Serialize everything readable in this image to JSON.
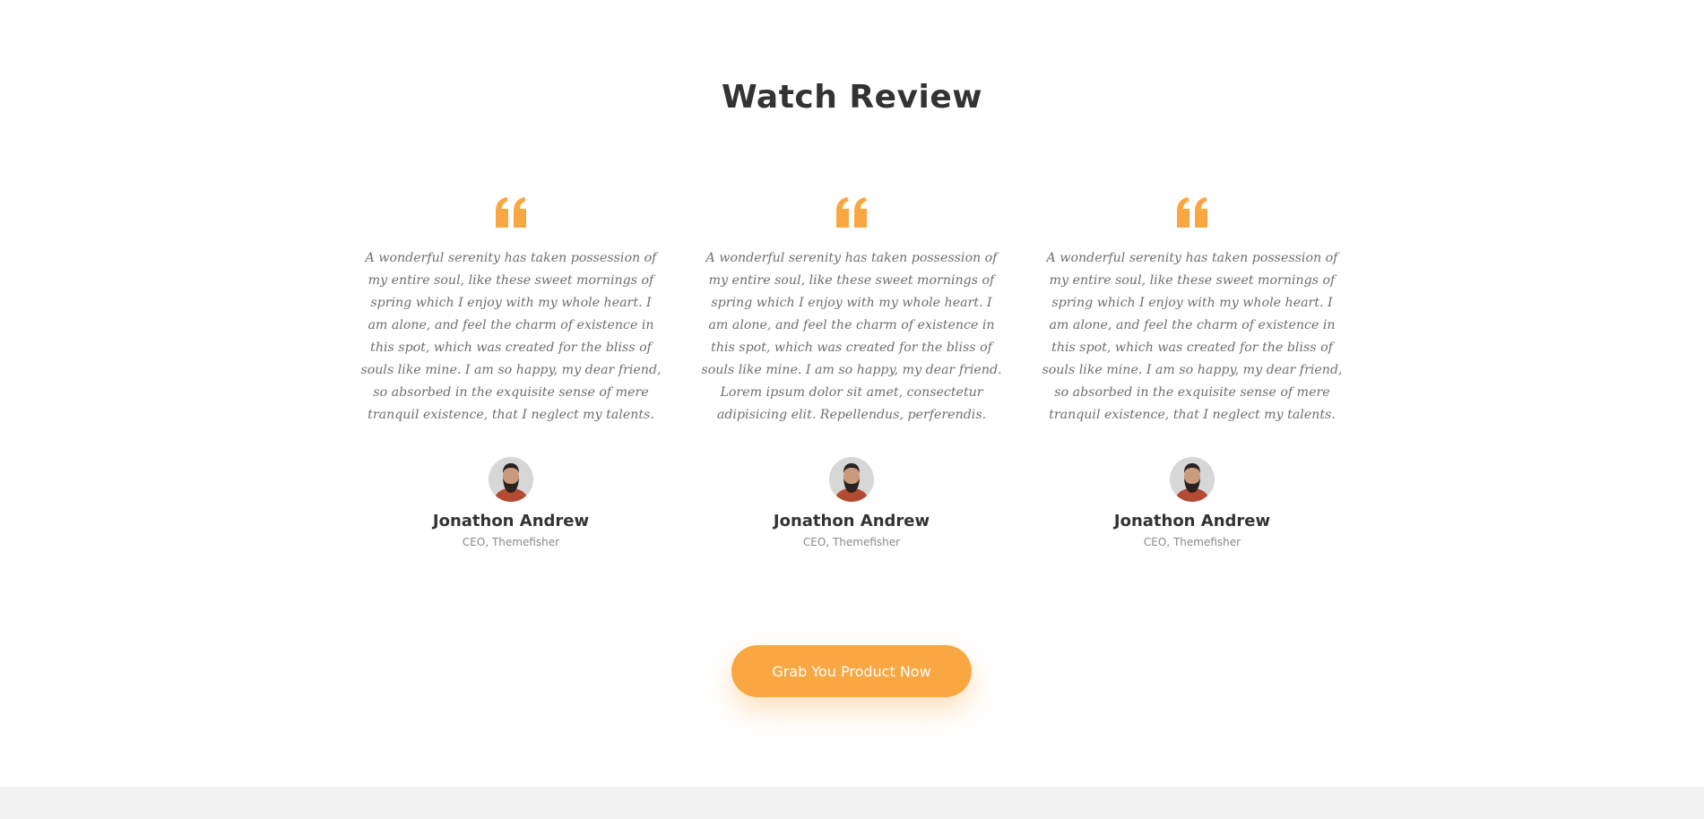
{
  "section": {
    "title": "Watch Review"
  },
  "colors": {
    "accent": "#f9a742",
    "heading": "#333333",
    "body_text": "#6f6f6f",
    "footer_band": "#f2f2f2"
  },
  "reviews": [
    {
      "quote_icon": "quote-left-icon",
      "text": "A wonderful serenity has taken possession of my entire soul, like these sweet mornings of spring which I enjoy with my whole heart. I am alone, and feel the charm of existence in this spot, which was created for the bliss of souls like mine. I am so happy, my dear friend, so absorbed in the exquisite sense of mere tranquil existence, that I neglect my talents.",
      "author": "Jonathon Andrew",
      "role": "CEO, Themefisher"
    },
    {
      "quote_icon": "quote-left-icon",
      "text": "A wonderful serenity has taken possession of my entire soul, like these sweet mornings of spring which I enjoy with my whole heart. I am alone, and feel the charm of existence in this spot, which was created for the bliss of souls like mine. I am so happy, my dear friend. Lorem ipsum dolor sit amet, consectetur adipisicing elit. Repellendus, perferendis.",
      "author": "Jonathon Andrew",
      "role": "CEO, Themefisher"
    },
    {
      "quote_icon": "quote-left-icon",
      "text": "A wonderful serenity has taken possession of my entire soul, like these sweet mornings of spring which I enjoy with my whole heart. I am alone, and feel the charm of existence in this spot, which was created for the bliss of souls like mine. I am so happy, my dear friend, so absorbed in the exquisite sense of mere tranquil existence, that I neglect my talents.",
      "author": "Jonathon Andrew",
      "role": "CEO, Themefisher"
    }
  ],
  "cta": {
    "label": "Grab You Product Now"
  }
}
